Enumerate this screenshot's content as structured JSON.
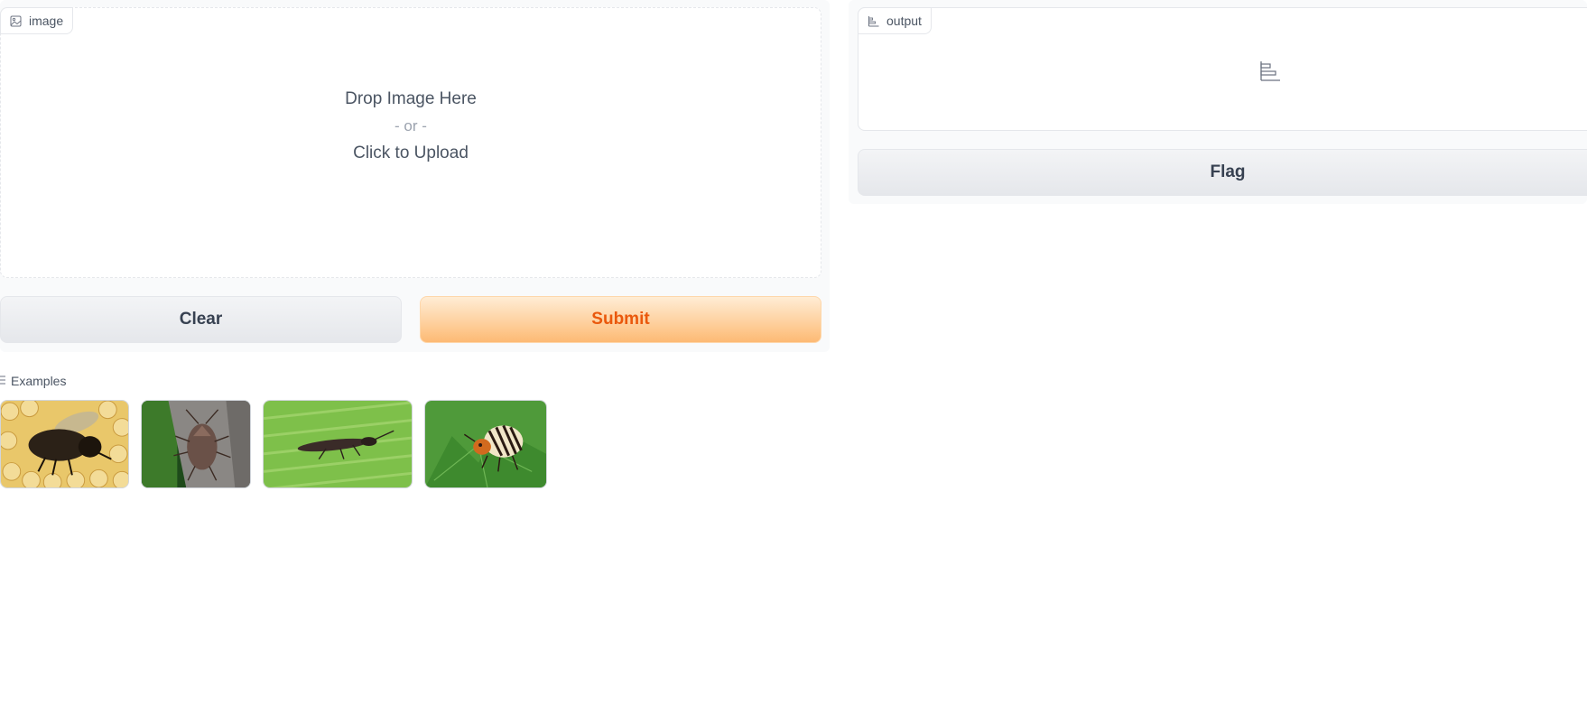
{
  "input": {
    "label": "image",
    "drop_text": "Drop Image Here",
    "or_text": "- or -",
    "upload_text": "Click to Upload"
  },
  "buttons": {
    "clear": "Clear",
    "submit": "Submit",
    "flag": "Flag"
  },
  "output": {
    "label": "output"
  },
  "examples": {
    "label": "Examples",
    "items": [
      {
        "subject": "bee on honeycomb"
      },
      {
        "subject": "brown stink bug on bark"
      },
      {
        "subject": "thrips on green leaf"
      },
      {
        "subject": "colorado potato beetle on leaf"
      }
    ]
  },
  "colors": {
    "accent": "#ea580c",
    "accent_light": "#fdba74",
    "panel_bg": "#f9fafb",
    "border": "#e5e7eb"
  },
  "icons": {
    "input_label": "image-icon",
    "output_label": "bar-chart-icon",
    "output_empty": "bar-chart-icon",
    "examples": "list-icon"
  }
}
